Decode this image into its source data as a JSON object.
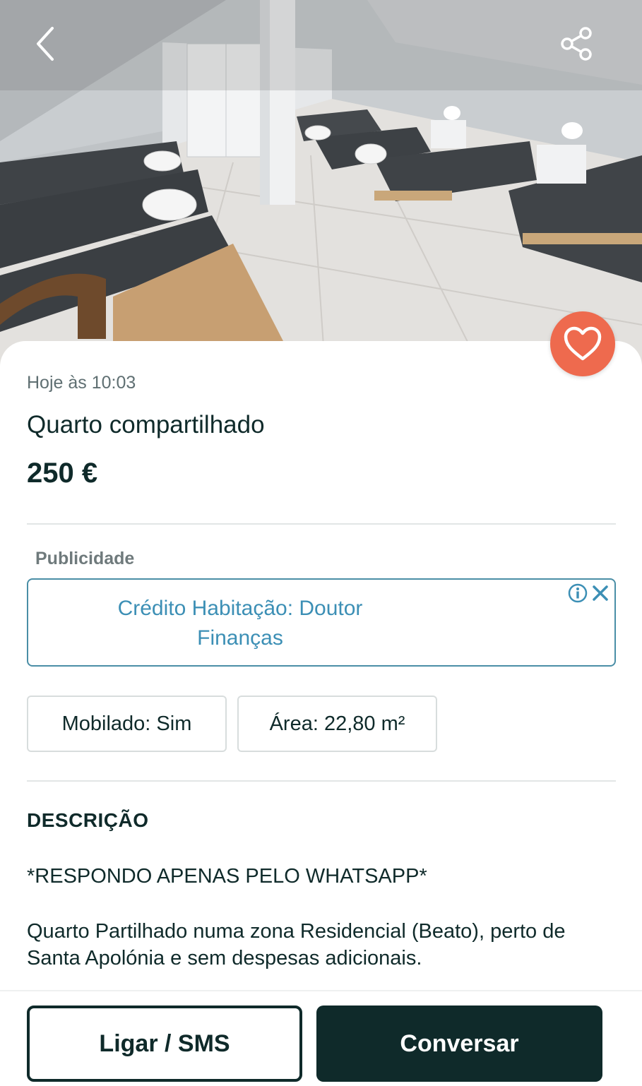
{
  "listing": {
    "timestamp": "Hoje às 10:03",
    "title": "Quarto compartilhado",
    "price": "250 €"
  },
  "ad": {
    "label": "Publicidade",
    "text_line1": "Crédito Habitação: Doutor",
    "text_line2": "Finanças"
  },
  "attributes": [
    {
      "text": "Mobilado: Sim"
    },
    {
      "text": "Área: 22,80 m²"
    }
  ],
  "description": {
    "heading": "DESCRIÇÃO",
    "line1": "*RESPONDO APENAS PELO WHATSAPP*",
    "paragraph": "Quarto Partilhado numa zona Residencial (Beato), perto de Santa Apolónia e sem despesas adicionais."
  },
  "actions": {
    "call_label": "Ligar / SMS",
    "chat_label": "Conversar"
  },
  "icons": {
    "back": "chevron-left-icon",
    "share": "share-icon",
    "favorite": "heart-icon",
    "ad_info": "info-icon",
    "ad_close": "close-icon"
  },
  "colors": {
    "primary": "#0f2a2a",
    "favorite": "#ee6a4e",
    "ad_text": "#3c8fb5",
    "ad_border": "#4a8ea6"
  }
}
